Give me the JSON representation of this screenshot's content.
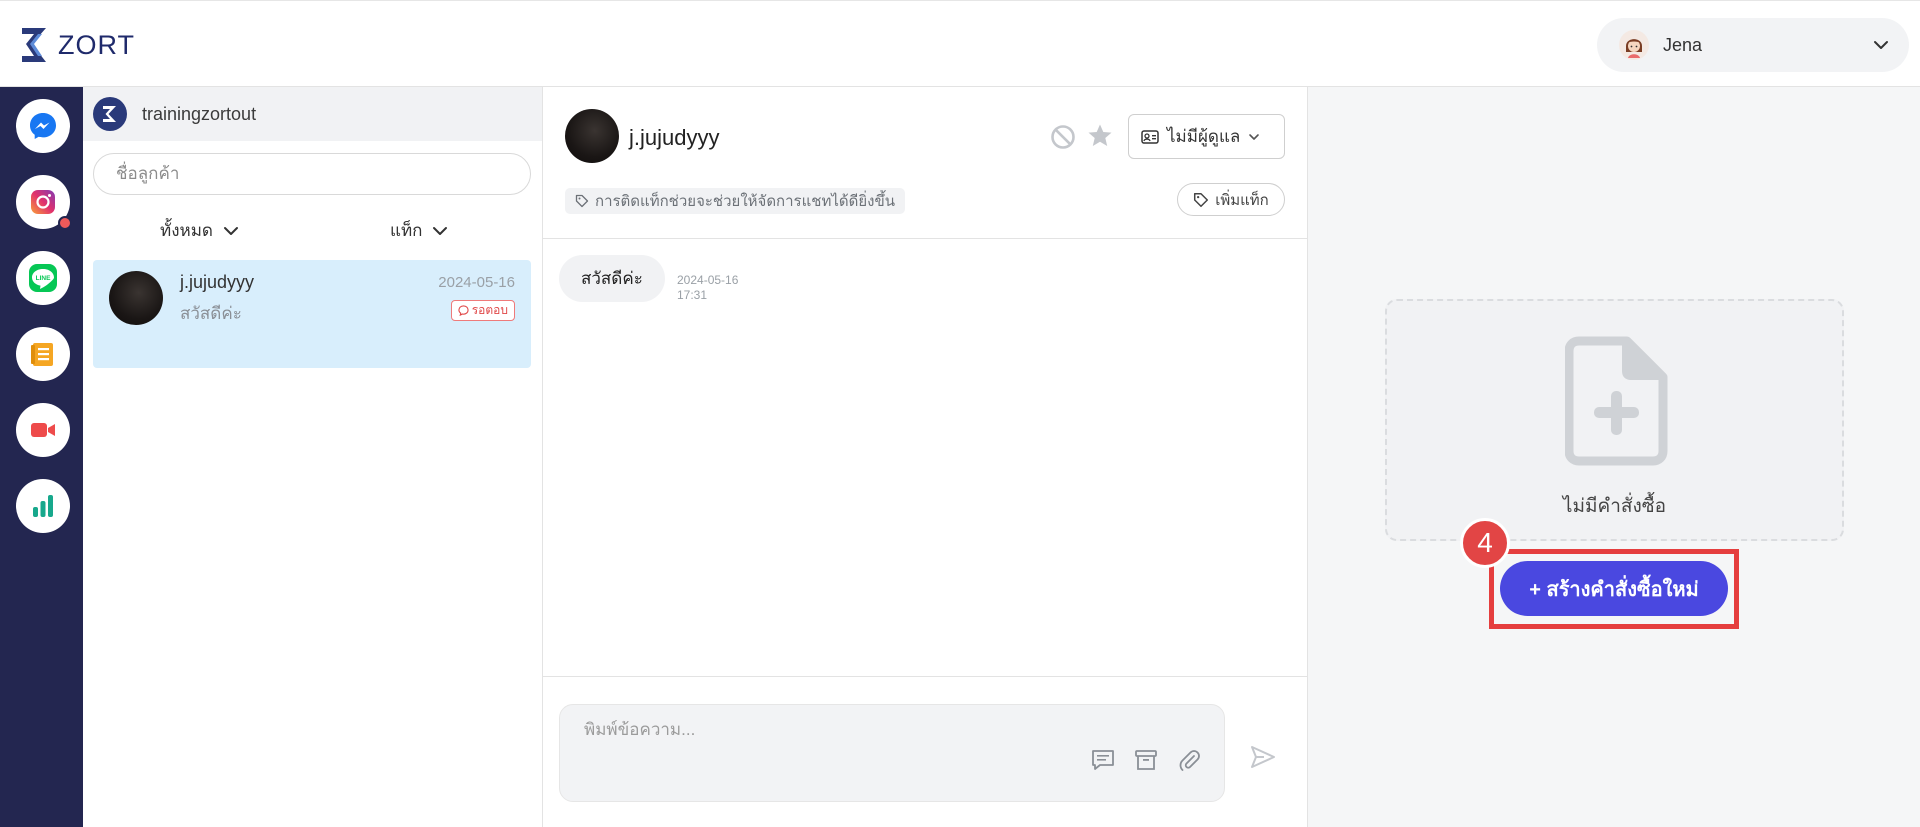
{
  "header": {
    "logo_text": "ZORT",
    "user_name": "Jena"
  },
  "rail": {
    "items": [
      {
        "name": "messenger",
        "icon": "messenger-icon",
        "color": "#1877f2"
      },
      {
        "name": "instagram",
        "icon": "instagram-icon",
        "color": "#e1306c",
        "has_notification": true
      },
      {
        "name": "line",
        "icon": "line-icon",
        "color": "#06c755"
      },
      {
        "name": "notes",
        "icon": "notes-icon",
        "color": "#f5a623"
      },
      {
        "name": "video",
        "icon": "video-icon",
        "color": "#ee4b4b"
      },
      {
        "name": "analytics",
        "icon": "chart-icon",
        "color": "#17a88c"
      }
    ]
  },
  "convlist": {
    "shop_name": "trainingzortout",
    "search_placeholder": "ชื่อลูกค้า",
    "filter_all": "ทั้งหมด",
    "filter_tag": "แท็ก",
    "conversations": [
      {
        "name": "j.jujudyyy",
        "preview": "สวัสดีค่ะ",
        "date": "2024-05-16",
        "badge": "รอตอบ"
      }
    ]
  },
  "chat": {
    "contact_name": "j.jujudyyy",
    "assign_label": "ไม่มีผู้ดูแล",
    "tag_hint": "การติดแท็กช่วยจะช่วยให้จัดการแชทได้ดียิ่งขึ้น",
    "add_tag_label": "เพิ่มแท็ก",
    "messages": [
      {
        "text": "สวัสดีค่ะ",
        "date": "2024-05-16",
        "time": "17:31"
      }
    ],
    "compose_placeholder": "พิมพ์ข้อความ..."
  },
  "orders": {
    "empty_label": "ไม่มีคำสั่งซื้อ",
    "create_button_label": "+ สร้างคำสั่งซื้อใหม่",
    "step_number": "4",
    "accent_color": "#4a48e0",
    "highlight_color": "#e53e3e"
  }
}
